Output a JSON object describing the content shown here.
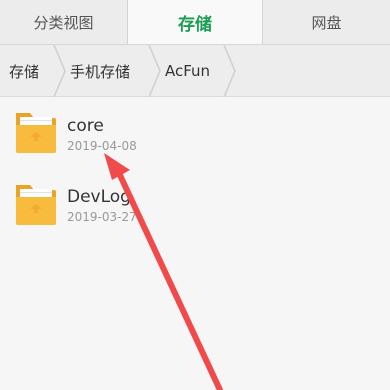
{
  "tabs": [
    {
      "label": "分类视图"
    },
    {
      "label": "存储"
    },
    {
      "label": "网盘"
    }
  ],
  "breadcrumb": [
    {
      "label": "存储"
    },
    {
      "label": "手机存储"
    },
    {
      "label": "AcFun"
    }
  ],
  "files": [
    {
      "name": "core",
      "date": "2019-04-08",
      "icon": "folder-icon"
    },
    {
      "name": "DevLog",
      "date": "2019-03-27",
      "icon": "folder-icon"
    }
  ],
  "colors": {
    "accent": "#1b9d54",
    "folder": "#f5b73a",
    "annotation_arrow": "#f04a4a"
  }
}
